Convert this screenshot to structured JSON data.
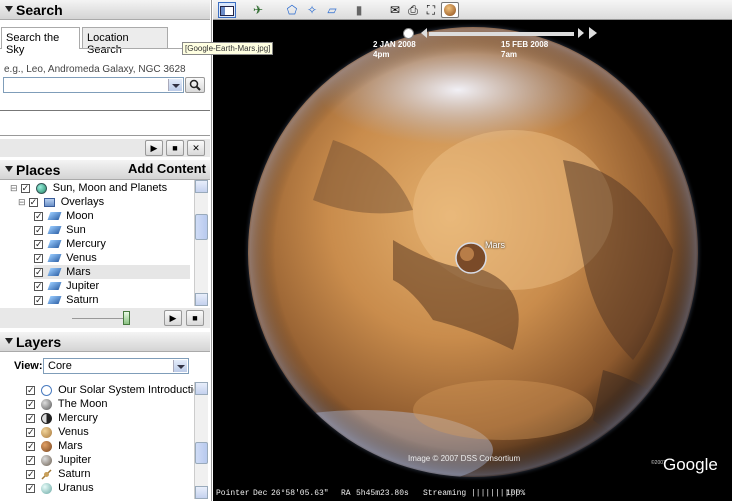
{
  "search": {
    "header": "Search",
    "tabs": [
      {
        "label": "Search the Sky",
        "active": true
      },
      {
        "label": "Location Search",
        "active": false
      }
    ],
    "hint": "e.g., Leo, Andromeda Galaxy, NGC 3628",
    "input_value": "",
    "tooltip": "[Google-Earth-Mars.jpg]",
    "controls": [
      "▶",
      "■",
      "✕"
    ]
  },
  "places": {
    "header": "Places",
    "add_content": "Add Content",
    "items": [
      {
        "label": "Sun, Moon and Planets",
        "indent": 0
      },
      {
        "label": "Overlays",
        "indent": 1
      },
      {
        "label": "Moon",
        "indent": 2
      },
      {
        "label": "Sun",
        "indent": 2
      },
      {
        "label": "Mercury",
        "indent": 2
      },
      {
        "label": "Venus",
        "indent": 2
      },
      {
        "label": "Mars",
        "indent": 2,
        "selected": true
      },
      {
        "label": "Jupiter",
        "indent": 2
      },
      {
        "label": "Saturn",
        "indent": 2
      }
    ],
    "tour_controls": [
      "▶",
      "■"
    ]
  },
  "layers": {
    "header": "Layers",
    "view_label": "View:",
    "view_value": "Core",
    "items": [
      {
        "label": "Our Solar System Introduction",
        "icon": "globe-icon",
        "color": "#ffffff"
      },
      {
        "label": "The Moon",
        "icon": "moon-icon",
        "color": "#6a6a6a"
      },
      {
        "label": "Mercury",
        "icon": "planet-icon",
        "color": "#2c2c2c"
      },
      {
        "label": "Venus",
        "icon": "planet-icon",
        "color": "#c89a58"
      },
      {
        "label": "Mars",
        "icon": "planet-icon",
        "color": "#b0703a"
      },
      {
        "label": "Jupiter",
        "icon": "planet-icon",
        "color": "#9c8f80"
      },
      {
        "label": "Saturn",
        "icon": "planet-icon",
        "color": "#c9a05a"
      },
      {
        "label": "Uranus",
        "icon": "planet-icon",
        "color": "#9fc3c0"
      }
    ]
  },
  "timeline": {
    "start_date": "2 JAN 2008",
    "start_time": "4pm",
    "end_date": "15 FEB 2008",
    "end_time": "7am"
  },
  "map": {
    "placemark_label": "Mars",
    "credit": "Image © 2007 DSS Consortium",
    "logo": "Google",
    "logo_prefix": "©2007"
  },
  "status": {
    "pointer": "Pointer",
    "dec_label": "Dec",
    "dec_value": "26°58'05.63\"",
    "ra_label": "RA",
    "ra_value": "5h45m23.80s",
    "streaming_label": "Streaming",
    "streaming_bar": "||||||||||",
    "streaming_pct": "100%"
  },
  "colors": {
    "sky": "#000000",
    "mars": "#c8884a",
    "panel_header": "#d8d8d8"
  }
}
